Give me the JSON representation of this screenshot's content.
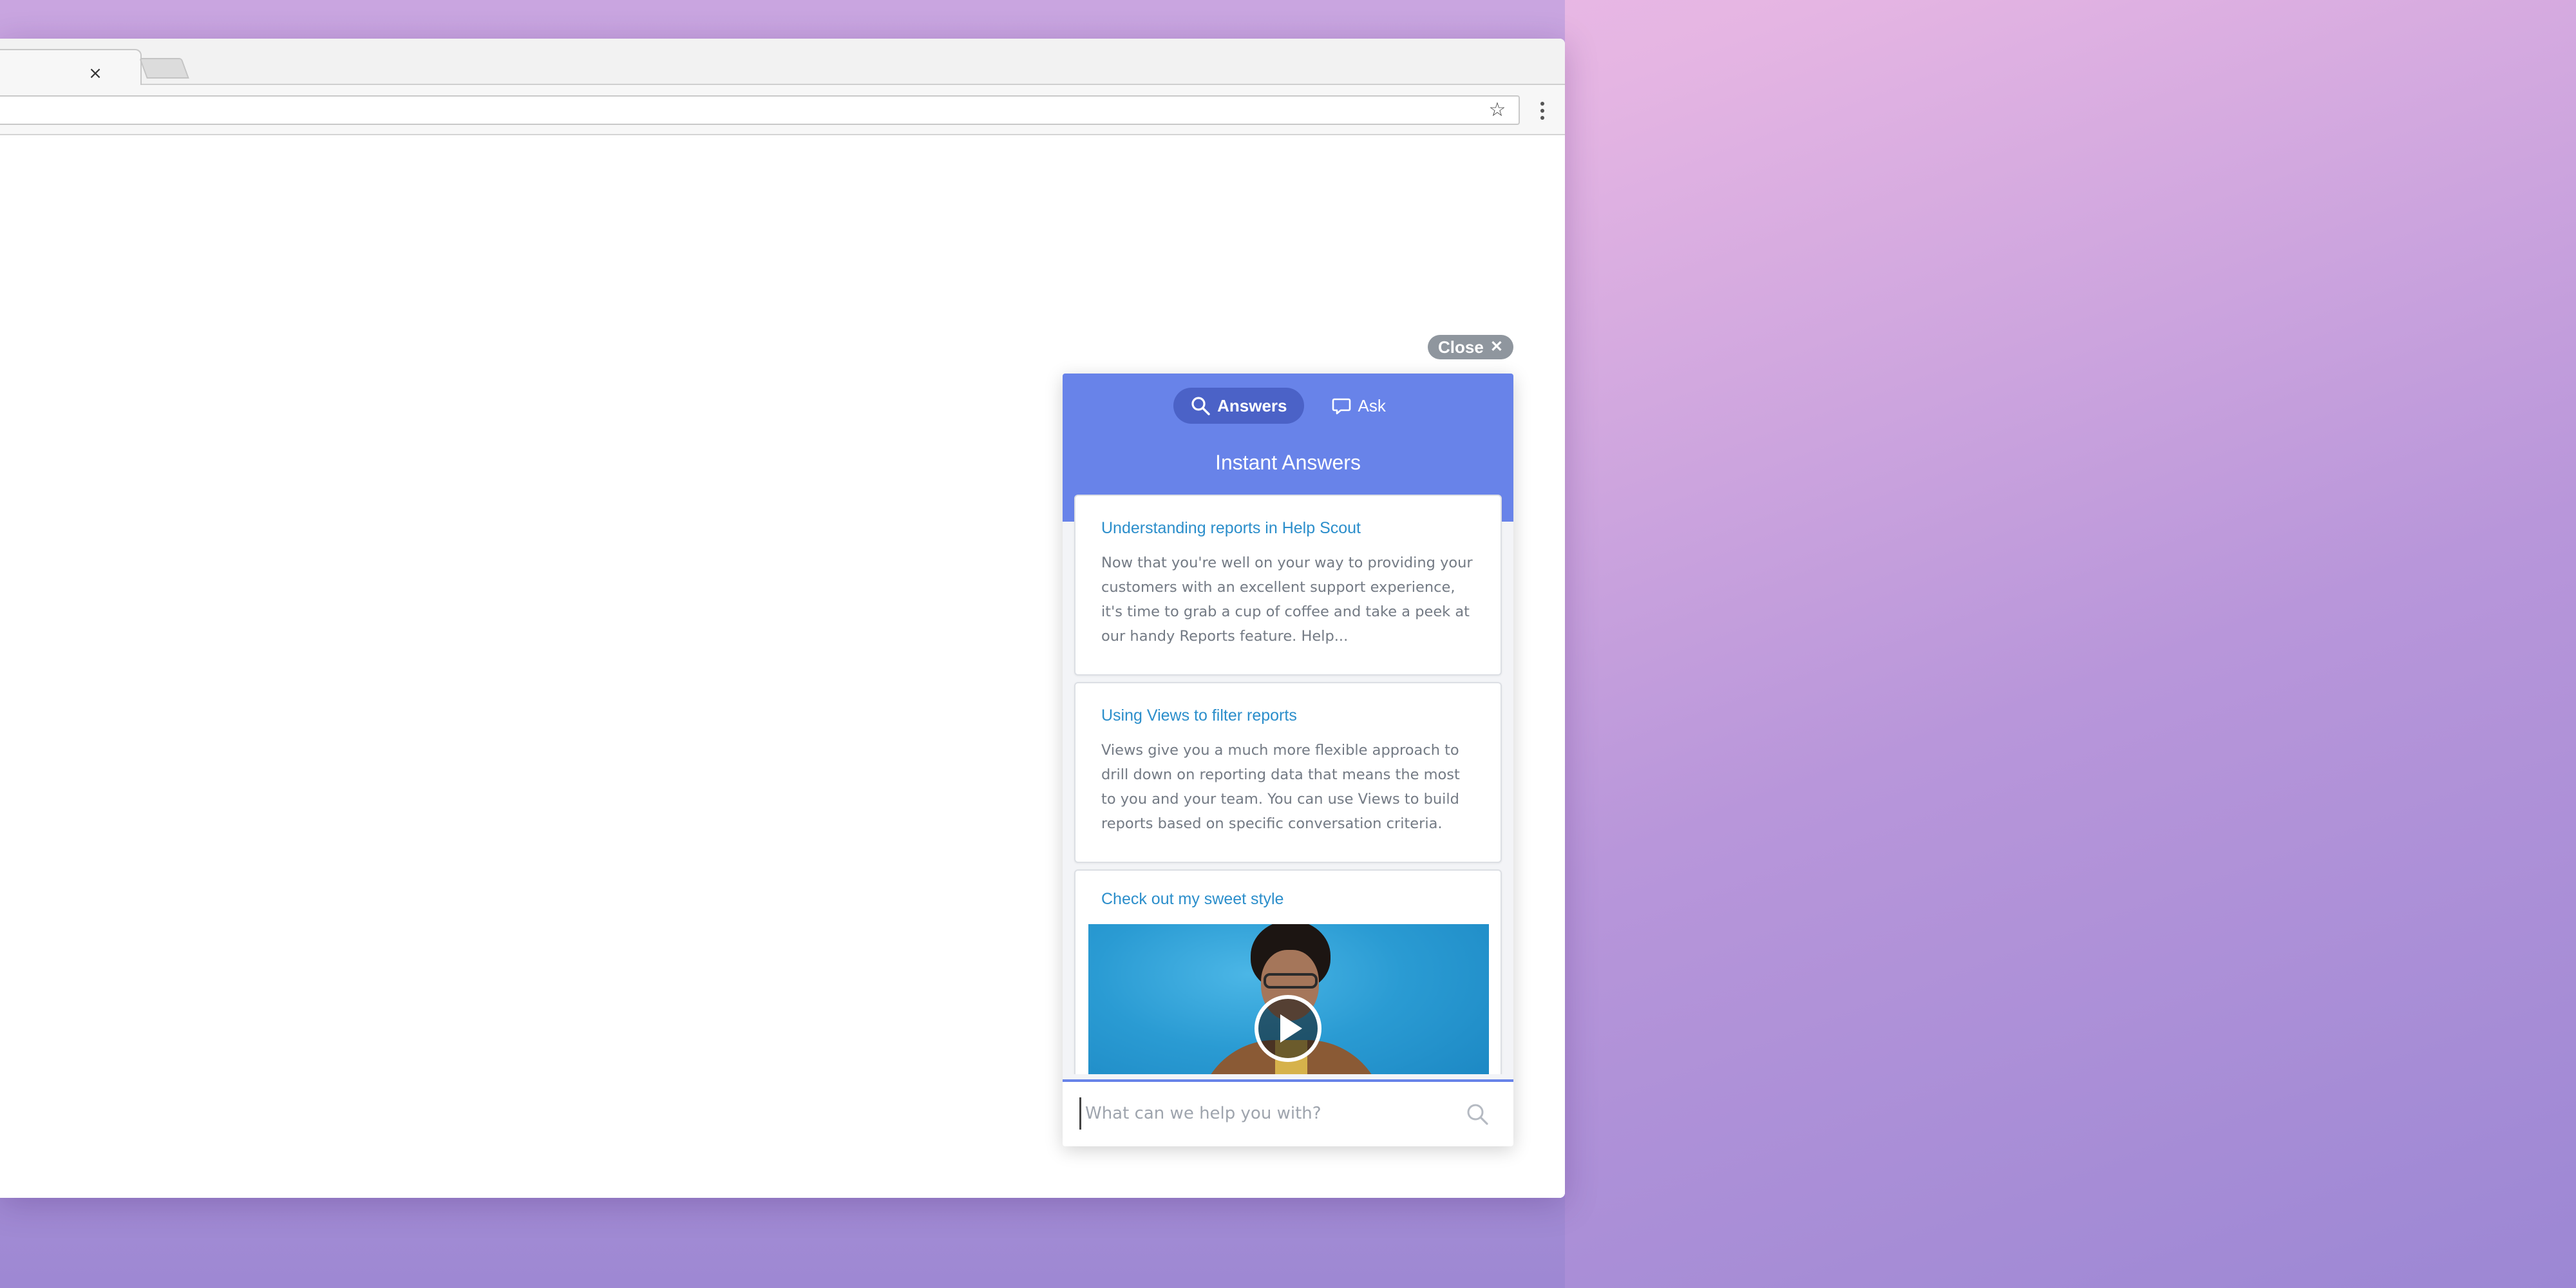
{
  "browser": {
    "tab_close_glyph": "×",
    "star_icon": "star-icon",
    "menu_icon": "kebab-menu-icon"
  },
  "beacon": {
    "close_label": "Close",
    "close_glyph": "✕",
    "tabs": [
      {
        "label": "Answers",
        "icon": "search-icon",
        "active": true
      },
      {
        "label": "Ask",
        "icon": "chat-bubble-icon",
        "active": false
      }
    ],
    "title": "Instant Answers",
    "results": [
      {
        "title": "Understanding reports in Help Scout",
        "body": "Now that you're well on your way to providing your customers with an excellent support experience, it's time to grab a cup of coffee and take a peek at our handy Reports feature. Help..."
      },
      {
        "title": "Using Views to filter reports",
        "body": "Views give you a much more flexible approach to drill down on reporting data that means the most to you and your team. You can use Views to build reports based on specific conversation criteria."
      },
      {
        "title": "Check out my sweet style",
        "media": "video"
      }
    ],
    "search": {
      "placeholder": "What can we help you with?",
      "value": ""
    },
    "colors": {
      "header": "#6883e9",
      "active_tab": "#4b62c7",
      "link": "#2b8ecb",
      "close_pill": "#8f969e"
    }
  }
}
